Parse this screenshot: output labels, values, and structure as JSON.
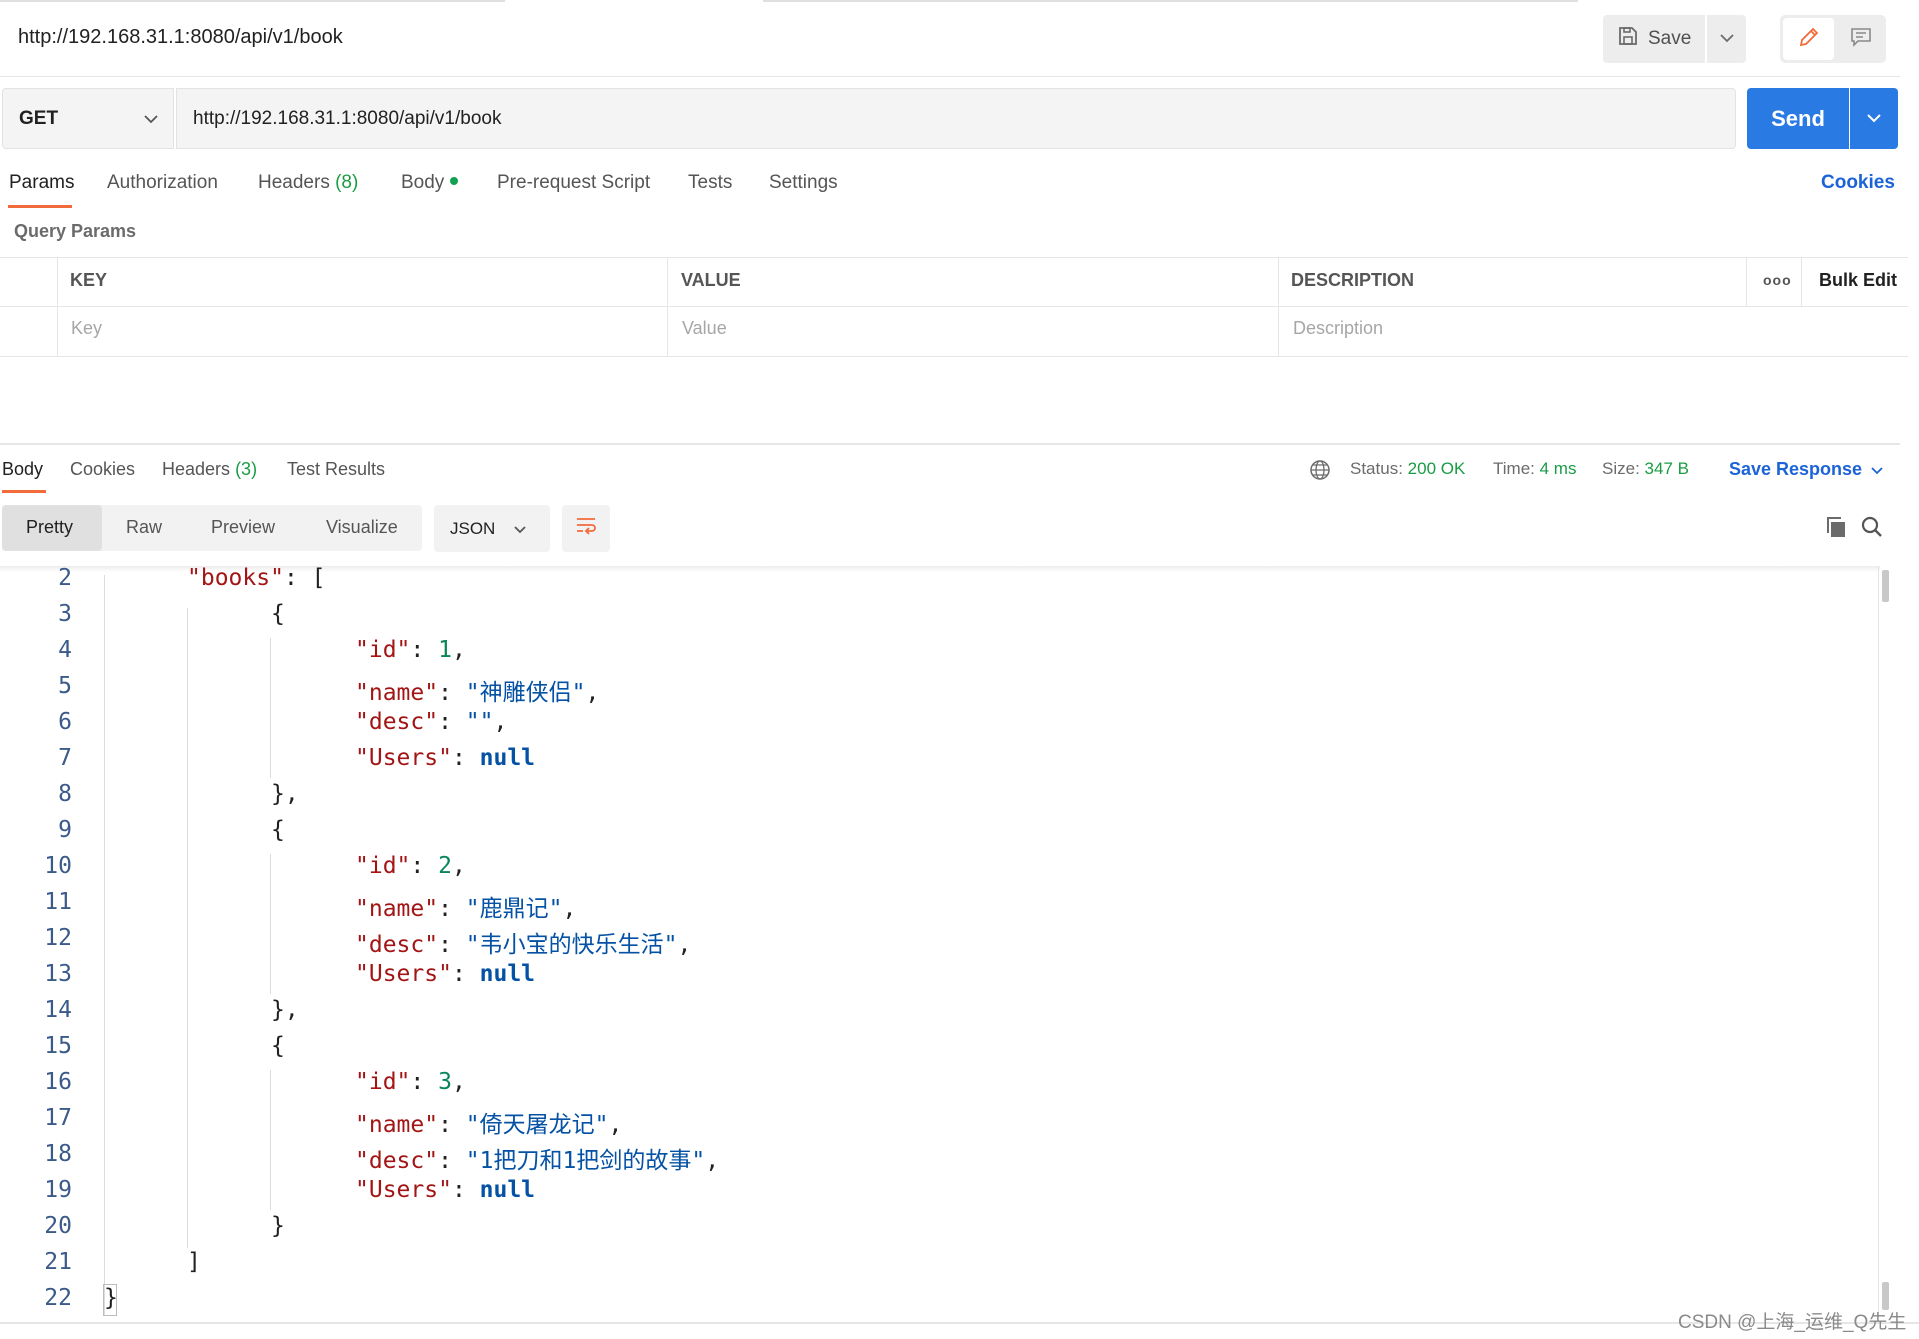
{
  "header": {
    "title": "http://192.168.31.1:8080/api/v1/book",
    "save_label": "Save"
  },
  "request": {
    "method": "GET",
    "url": "http://192.168.31.1:8080/api/v1/book",
    "send_label": "Send"
  },
  "request_tabs": {
    "params": "Params",
    "authorization": "Authorization",
    "headers": "Headers",
    "headers_count": "(8)",
    "body": "Body",
    "pre_request": "Pre-request Script",
    "tests": "Tests",
    "settings": "Settings",
    "cookies": "Cookies"
  },
  "query_params": {
    "label": "Query Params",
    "col_key": "KEY",
    "col_value": "VALUE",
    "col_description": "DESCRIPTION",
    "more": "ooo",
    "bulk_edit": "Bulk Edit",
    "placeholder_key": "Key",
    "placeholder_value": "Value",
    "placeholder_description": "Description"
  },
  "response_tabs": {
    "body": "Body",
    "cookies": "Cookies",
    "headers": "Headers",
    "headers_count": "(3)",
    "test_results": "Test Results"
  },
  "response_meta": {
    "status_label": "Status:",
    "status_value": "200 OK",
    "time_label": "Time:",
    "time_value": "4 ms",
    "size_label": "Size:",
    "size_value": "347 B",
    "save_response": "Save Response"
  },
  "format": {
    "pretty": "Pretty",
    "raw": "Raw",
    "preview": "Preview",
    "visualize": "Visualize",
    "language": "JSON"
  },
  "code": {
    "line_numbers": [
      "2",
      "3",
      "4",
      "5",
      "6",
      "7",
      "8",
      "9",
      "10",
      "11",
      "12",
      "13",
      "14",
      "15",
      "16",
      "17",
      "18",
      "19",
      "20",
      "21",
      "22"
    ],
    "books_key": "\"books\"",
    "id_key": "\"id\"",
    "name_key": "\"name\"",
    "desc_key": "\"desc\"",
    "users_key": "\"Users\"",
    "null_value": "null",
    "books": [
      {
        "id": "1",
        "name": "\"神雕侠侣\"",
        "desc": "\"\""
      },
      {
        "id": "2",
        "name": "\"鹿鼎记\"",
        "desc": "\"韦小宝的快乐生活\""
      },
      {
        "id": "3",
        "name": "\"倚天屠龙记\"",
        "desc": "\"1把刀和1把剑的故事\""
      }
    ]
  },
  "watermark": "CSDN @上海_运维_Q先生",
  "colors": {
    "accent": "#2a7ae4",
    "tab_underline": "#f26b3a",
    "success": "#1a9c45",
    "link": "#1c63d8"
  }
}
